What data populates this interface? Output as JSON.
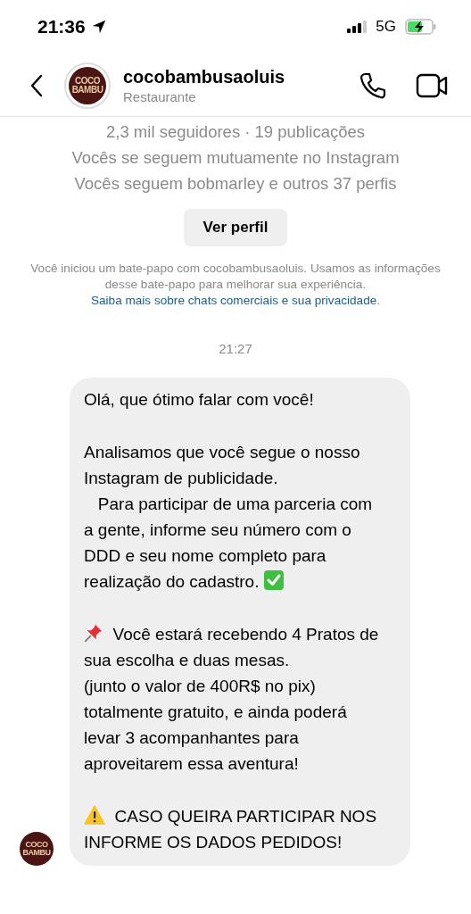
{
  "status_bar": {
    "time": "21:36",
    "network": "5G"
  },
  "header": {
    "username": "cocobambusaoluis",
    "category": "Restaurante",
    "avatar_text": [
      "COCO",
      "BAMBU"
    ]
  },
  "profile_info": [
    "2,3 mil seguidores · 19 publicações",
    "Vocês se seguem mutuamente no Instagram",
    "Vocês seguem bobmarley e outros 37 perfis"
  ],
  "view_profile_button": "Ver perfil",
  "notice": {
    "text": "Você iniciou um bate-papo com cocobambusaoluis. Usamos as informações desse bate-papo para melhorar sua experiência.",
    "link": "Saiba mais sobre chats comerciais e sua privacidade",
    "end": "."
  },
  "timestamp": "21:27",
  "message": {
    "avatar_text": [
      "COCO",
      "BAMBU"
    ],
    "paragraphs": [
      {
        "text": "Olá, que ótimo falar com você!"
      },
      {
        "text": "Analisamos que você segue o nosso Instagram de publicidade.\n   Para participar de uma parceria com a gente, informe seu número com o DDD e seu nome completo para realização do cadastro.",
        "kind": "check_end"
      },
      {
        "kind": "pin_lead",
        "text": "Você estará recebendo 4 Pratos de sua escolha e duas mesas.\n(junto o valor de 400R$ no pix) totalmente gratuito, e ainda poderá levar 3 acompanhantes para aproveitarem essa aventura!"
      },
      {
        "kind": "warning_lead",
        "text": "CASO QUEIRA PARTICIPAR NOS INFORME OS DADOS PEDIDOS!"
      }
    ]
  }
}
